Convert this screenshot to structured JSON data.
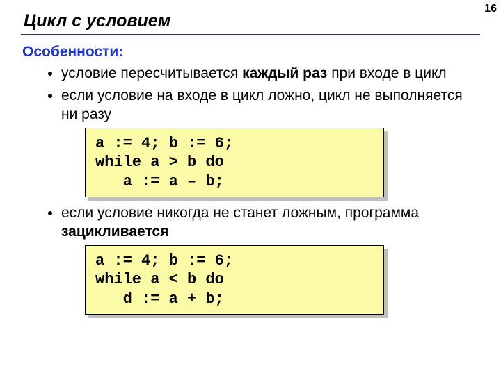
{
  "pageNumber": "16",
  "title": "Цикл с условием",
  "subheading": "Особенности:",
  "bullets": {
    "b1_prefix": "условие пересчитывается ",
    "b1_bold": "каждый раз",
    "b1_suffix": " при входе в цикл",
    "b2": "если условие на входе в цикл ложно, цикл не выполняется ни разу",
    "b3_prefix": "если условие никогда не станет ложным, программа ",
    "b3_bold": "зацикливается"
  },
  "code1": "a := 4; b := 6;\nwhile a > b do\n   a := a – b;",
  "code2": "a := 4; b := 6;\nwhile a < b do\n   d := a + b;"
}
